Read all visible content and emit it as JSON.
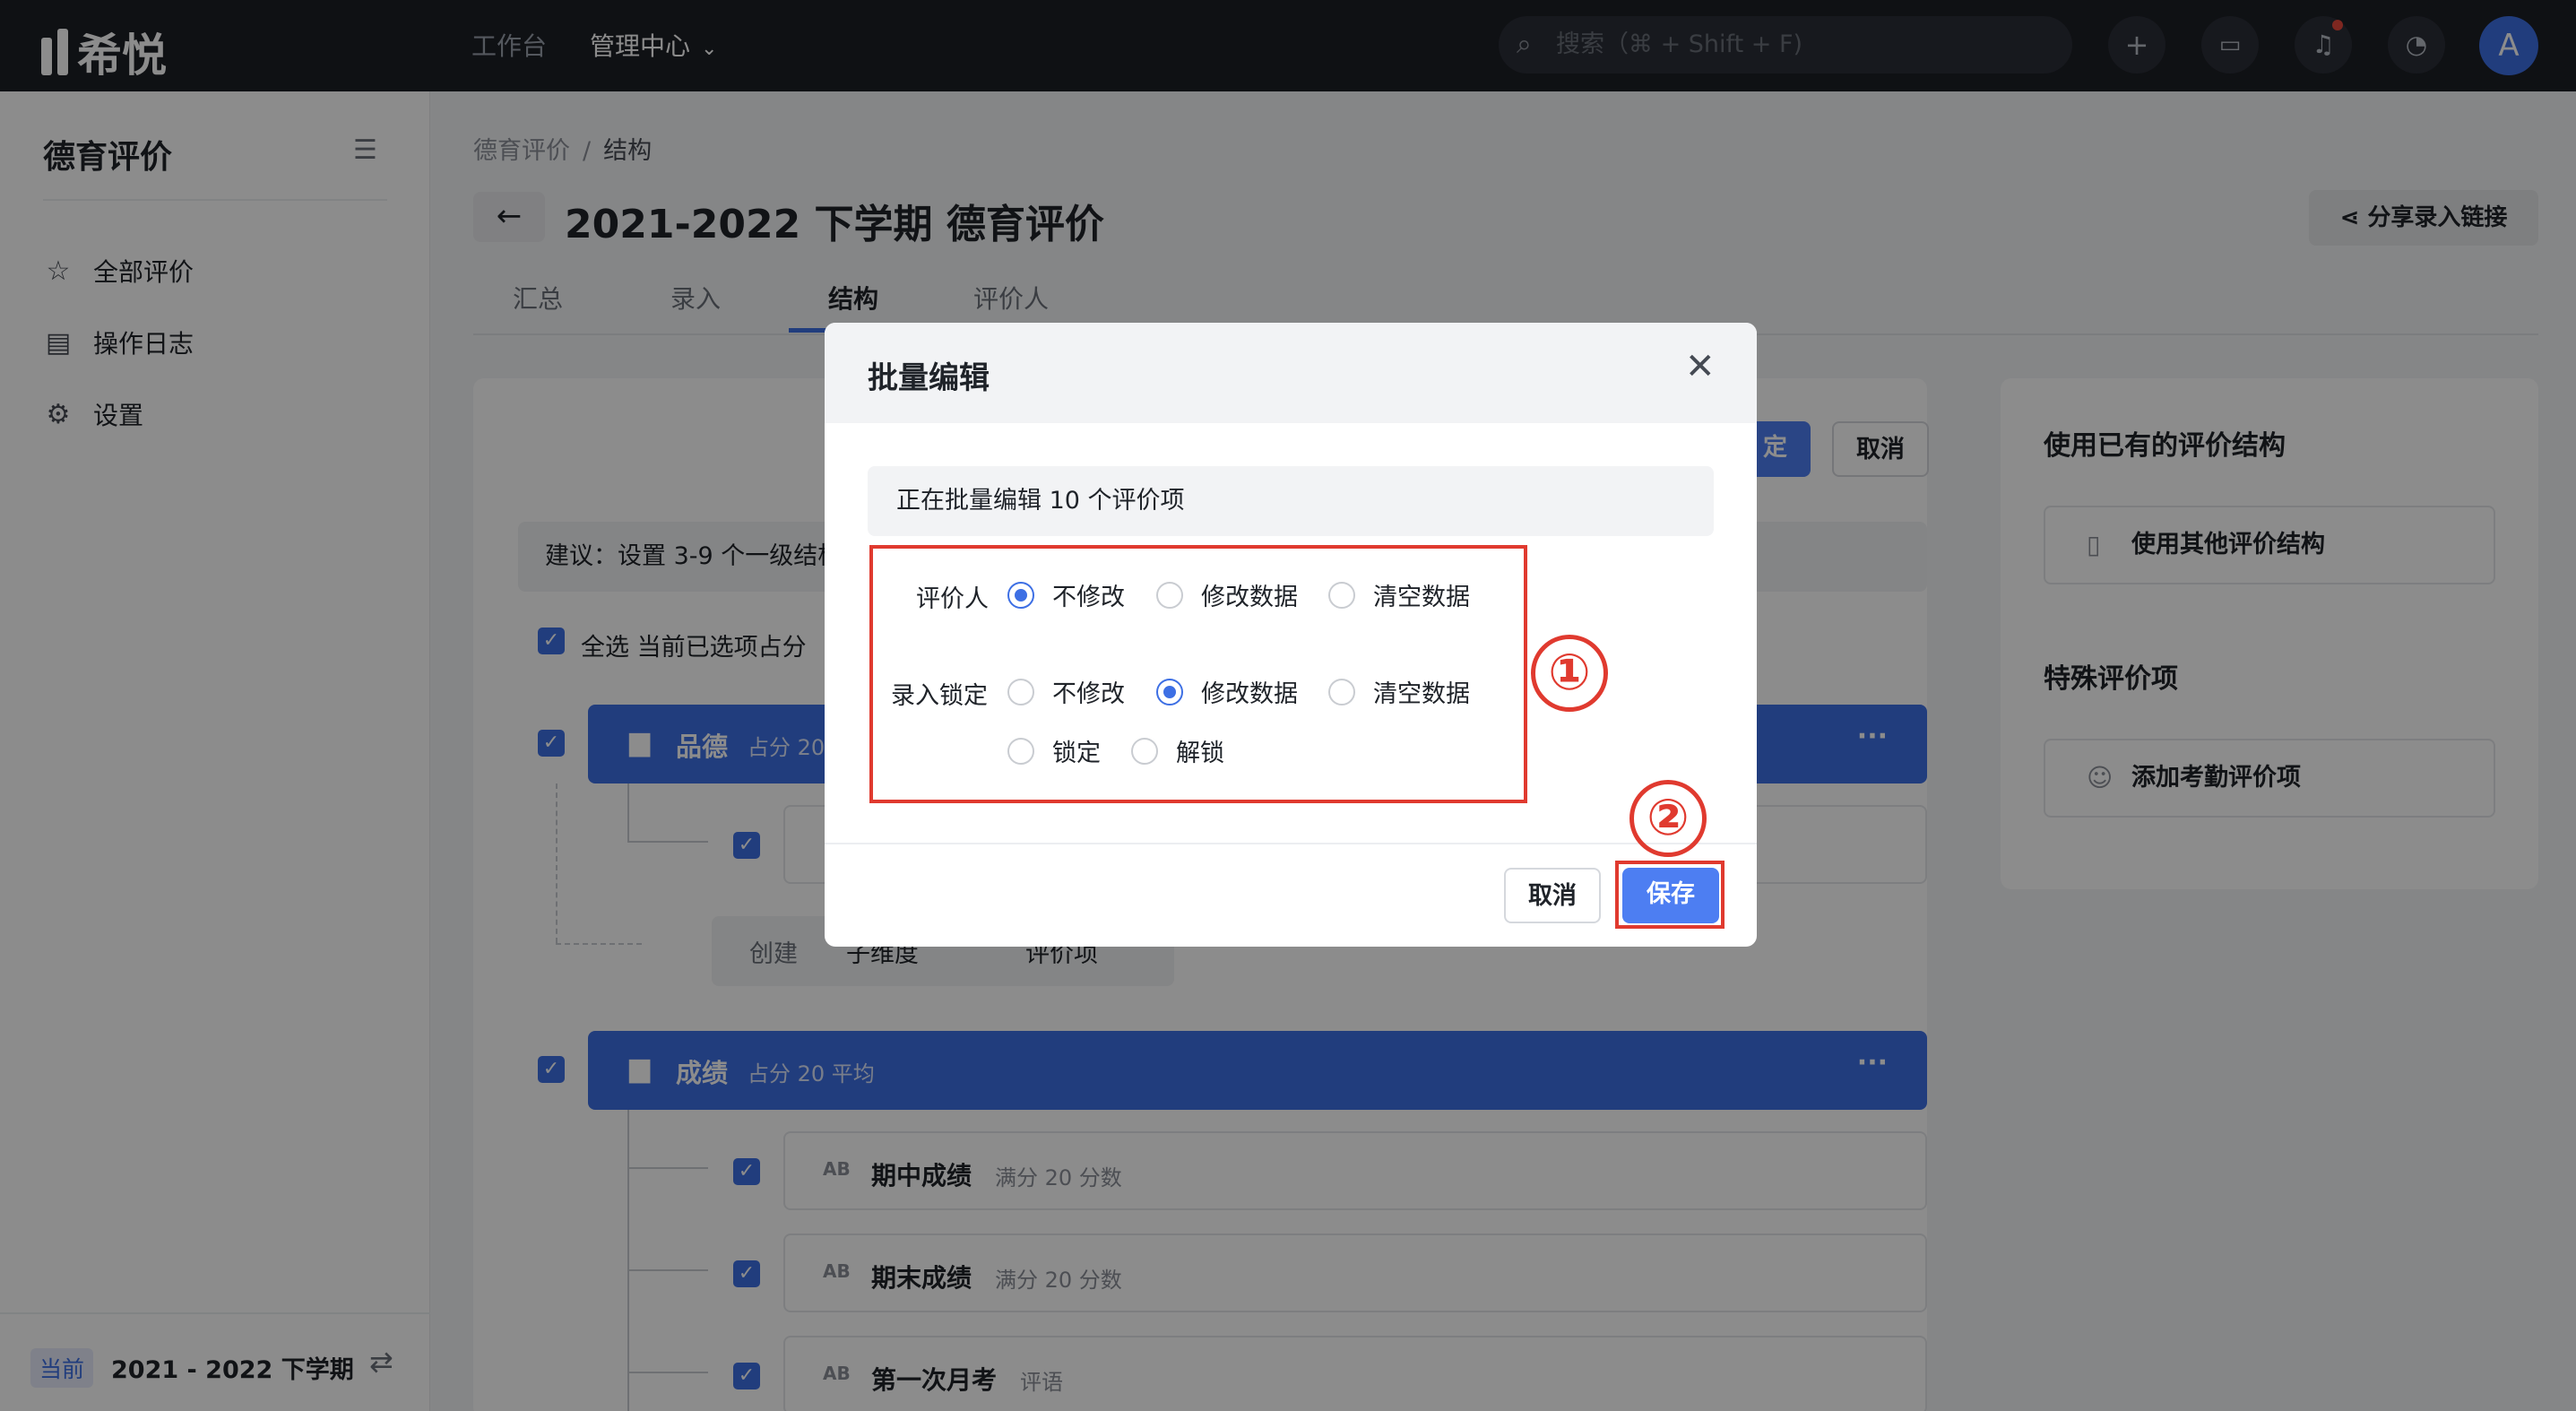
{
  "topbar": {
    "logo_text": "希悦",
    "nav": [
      {
        "label": "工作台"
      },
      {
        "label": "管理中心"
      }
    ],
    "search_placeholder": "搜索（⌘ + Shift + F)",
    "avatar_letter": "A",
    "icons": [
      "plus-icon",
      "chat-icon",
      "bell-icon",
      "dashboard-icon"
    ]
  },
  "sidebar": {
    "title": "德育评价",
    "items": [
      {
        "label": "全部评价",
        "icon": "star-icon"
      },
      {
        "label": "操作日志",
        "icon": "log-icon"
      },
      {
        "label": "设置",
        "icon": "gear-icon"
      }
    ],
    "footer": {
      "badge": "当前",
      "term": "2021 - 2022 下学期"
    }
  },
  "main": {
    "breadcrumb": [
      "德育评价",
      "结构"
    ],
    "breadcrumb_sep": "/",
    "title": "2021-2022 下学期 德育评价",
    "share_label": "分享录入链接",
    "tabs": [
      {
        "label": "汇总"
      },
      {
        "label": "录入"
      },
      {
        "label": "结构"
      },
      {
        "label": "评价人"
      }
    ],
    "confirm_partial": "定",
    "cancel_label": "取消",
    "hint": "建议：设置 3-9 个一级结构",
    "select_all": "全选  当前已选项占分",
    "groups": [
      {
        "name": "品德",
        "meta": "占分 20",
        "more": "···"
      },
      {
        "name": "成绩",
        "meta": "占分 20 平均",
        "more": "···"
      }
    ],
    "create": {
      "label": "创建",
      "dim": "子维度",
      "item": "评价项"
    },
    "items": [
      {
        "ab": "AB",
        "name": "期中成绩",
        "meta": "满分 20    分数"
      },
      {
        "ab": "AB",
        "name": "期末成绩",
        "meta": "满分 20    分数"
      },
      {
        "ab": "AB",
        "name": "第一次月考",
        "meta": "评语"
      }
    ]
  },
  "side": {
    "title1": "使用已有的评价结构",
    "btn1": "使用其他评价结构",
    "title2": "特殊评价项",
    "btn2": "添加考勤评价项"
  },
  "modal": {
    "title": "批量编辑",
    "close": "✕",
    "info": "正在批量编辑 10 个评价项",
    "fields": [
      {
        "label": "评价人",
        "options": [
          "不修改",
          "修改数据",
          "清空数据"
        ],
        "selected": "不修改"
      },
      {
        "label": "录入锁定",
        "options": [
          "不修改",
          "修改数据",
          "清空数据"
        ],
        "selected": "修改数据"
      }
    ],
    "lock_options": [
      "锁定",
      "解锁"
    ],
    "cancel": "取消",
    "save": "保存"
  },
  "annotations": {
    "one": "①",
    "two": "②",
    "color": "#e03a2f"
  },
  "colors": {
    "primary": "#3d6fe4",
    "topbar": "#1d1f26"
  }
}
